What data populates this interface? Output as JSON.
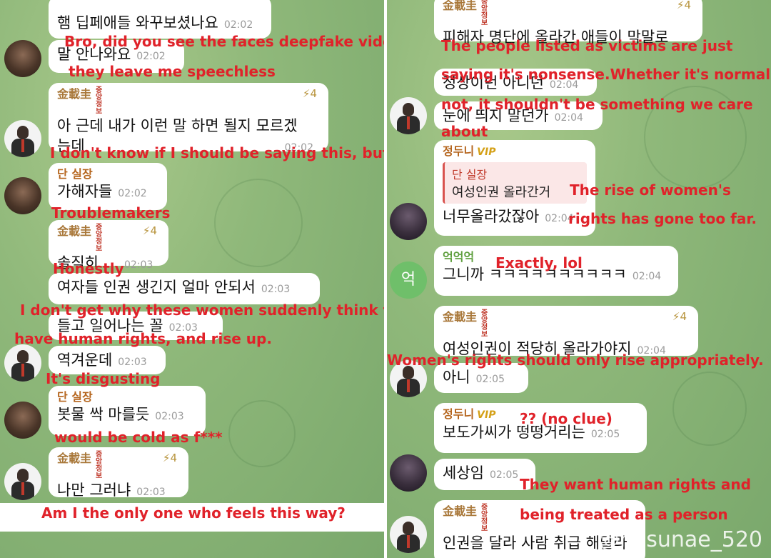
{
  "left": {
    "messages": [
      {
        "text": "햄 딥페애들 와꾸보셨나요",
        "time": "02:02"
      },
      {
        "text": "말 안나와요",
        "time": "02:02"
      },
      {
        "name": "金載圭",
        "seal": "중앙정보",
        "boost": "⚡4",
        "text": "아 근데 내가 이런 말 하면 될지 모르겠",
        "text2": "는데",
        "time": "02:02"
      },
      {
        "name": "단 실장",
        "text": "가해자들",
        "time": "02:02"
      },
      {
        "name": "金載圭",
        "seal": "중앙정보",
        "boost": "⚡4",
        "text": "솔직히",
        "time": "02:03"
      },
      {
        "text": "여자들 인권 생긴지 얼마 안되서",
        "time": "02:03"
      },
      {
        "text": "들고 일어나는 꼴",
        "time": "02:03"
      },
      {
        "text": "역겨운데",
        "time": "02:03"
      },
      {
        "name": "단 실장",
        "text": "봇물 싹 마를듯",
        "time": "02:03"
      },
      {
        "name": "金載圭",
        "seal": "중앙정보",
        "boost": "⚡4",
        "text": "나만 그러냐",
        "time": "02:03"
      }
    ],
    "captions": [
      "Bro, did you see the faces deepfake videos?",
      "they leave me speechless",
      "I don't know if I should be saying this, but",
      "Troublemakers",
      "Honestly",
      "I don't get why these women suddenly think they",
      "have human rights, and rise up.",
      "It's disgusting",
      "would be cold as f***",
      "Am I the only one who feels this way?"
    ]
  },
  "right": {
    "messages": [
      {
        "name": "金載圭",
        "seal": "중앙정보",
        "boost": "⚡4",
        "text": "피해자 명단에 올라간 애들이 막말로",
        "time": ""
      },
      {
        "text": "정상이던 아니던",
        "time": "02:04"
      },
      {
        "text": "눈에 띄지 말던가",
        "time": "02:04"
      },
      {
        "name": "정두니",
        "vip": "VIP",
        "reply_name": "단 실장",
        "reply_text": "여성인권 올라간거",
        "text": "너무올라갔잖아",
        "time": "02:04"
      },
      {
        "name": "억억억",
        "text": "그니까 ㅋㅋㅋㅋㅋㅋㅋㅋㅋㅋ",
        "time": "02:04",
        "avatar_letter": "억"
      },
      {
        "name": "金載圭",
        "seal": "중앙정보",
        "boost": "⚡4",
        "text": "여성인권이 적당히 올라가야지",
        "time": "02:04"
      },
      {
        "text": "아니",
        "time": "02:05"
      },
      {
        "name": "정두니",
        "vip": "VIP",
        "text": "보도가씨가 떵떵거리는",
        "time": "02:05"
      },
      {
        "text": "세상임",
        "time": "02:05"
      },
      {
        "name": "金載圭",
        "seal": "중앙정보",
        "text": "인권을 달라 사람 취급 해달라",
        "time": ""
      }
    ],
    "captions": [
      "The people listed as victims are just",
      "saying it's nonsense.Whether it's normal or",
      "not, it shouldn't be something we care",
      "about",
      "The rise of women's",
      "rights has gone too far.",
      "Exactly, lol",
      "Women's rights should only rise appropriately.",
      "?? (no clue)",
      "They want human rights and",
      "being treated as a person"
    ]
  },
  "watermark": "@nosunae_520",
  "colors": {
    "caption": "#e0222a",
    "name_gold": "#a9783a",
    "background": "#8fb87a"
  }
}
